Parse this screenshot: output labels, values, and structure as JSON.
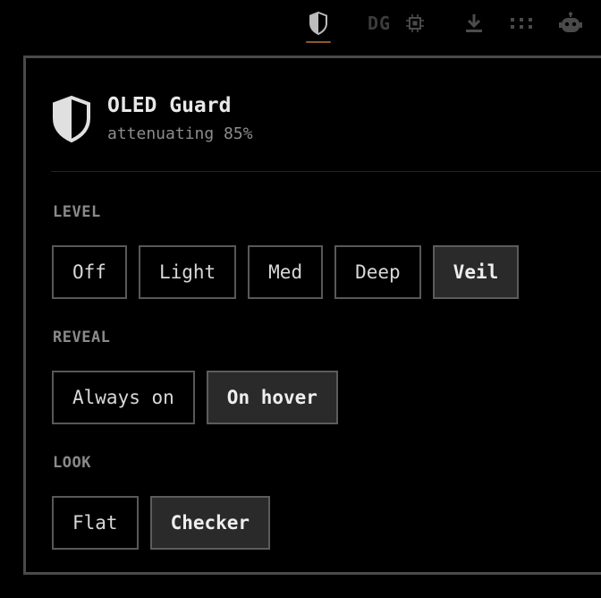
{
  "toolbar": {
    "items": [
      {
        "icon": "shield-icon",
        "active": true,
        "accent": "#8a5a2e"
      },
      {
        "label": "DG"
      },
      {
        "icon": "cpu-icon"
      },
      {
        "icon": "download-icon"
      },
      {
        "icon": "grid-dots-icon"
      },
      {
        "icon": "robot-icon"
      }
    ]
  },
  "panel": {
    "title": "OLED Guard",
    "status": "attenuating 85%",
    "sections": {
      "level": {
        "label": "LEVEL",
        "options": [
          "Off",
          "Light",
          "Med",
          "Deep",
          "Veil"
        ],
        "selected": "Veil"
      },
      "reveal": {
        "label": "REVEAL",
        "options": [
          "Always on",
          "On hover"
        ],
        "selected": "On hover"
      },
      "look": {
        "label": "LOOK",
        "options": [
          "Flat",
          "Checker"
        ],
        "selected": "Checker"
      }
    }
  },
  "colors": {
    "background": "#000000",
    "panel_border": "#4a4a4a",
    "selected_fill": "#2a2a2a",
    "accent": "#8a5a2e"
  }
}
